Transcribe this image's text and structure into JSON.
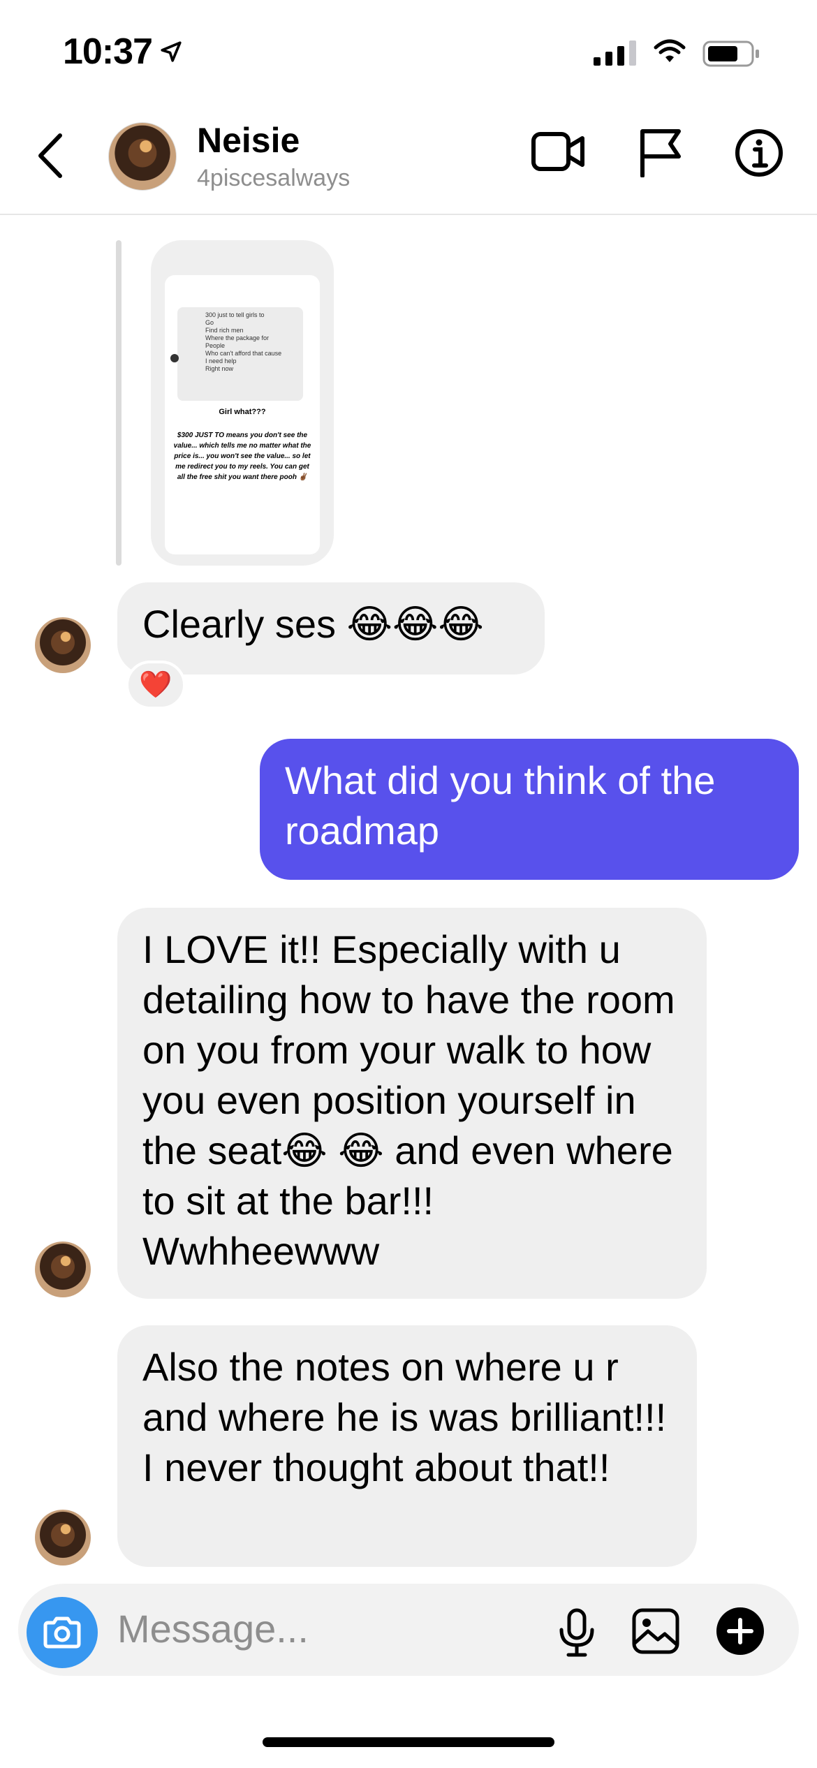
{
  "status": {
    "time": "10:37",
    "location_icon": "location-arrow-icon",
    "signal_icon": "cellular-signal-icon",
    "wifi_icon": "wifi-icon",
    "battery_icon": "battery-icon"
  },
  "header": {
    "name": "Neisie",
    "username": "4piscesalways",
    "back_icon": "chevron-left-icon",
    "actions": [
      "video-call-icon",
      "flag-icon",
      "info-icon"
    ]
  },
  "shared_story": {
    "quote": "300 just to tell girls to\nGo\nFind rich men\nWhere the package for\nPeople\nWho can't afford that cause\nI need help\nRight now",
    "title": "Girl what???",
    "body": "$300 JUST TO means you don't see the value... which tells me no matter what the price is... you won't see the value... so let me redirect you to my reels. You can get all the free shit you want there pooh ✌🏾"
  },
  "messages": [
    {
      "from": "them",
      "text": "Clearly ses 😂😂😂",
      "reaction": "❤️"
    },
    {
      "from": "me",
      "text": "What did you think of the roadmap"
    },
    {
      "from": "them",
      "text": "I LOVE it!! Especially with u detailing how to have the room on you from your walk to how you even position yourself in the seat😂 😂 and even where to sit at the bar!!!  Wwhheewww"
    },
    {
      "from": "them",
      "text": "Also the notes on where u r and where he is was brilliant!!! I never thought about that!!"
    }
  ],
  "composer": {
    "placeholder": "Message...",
    "icons": [
      "camera-icon",
      "microphone-icon",
      "image-icon",
      "plus-icon"
    ]
  },
  "colors": {
    "outgoing_bubble": "#5851ec",
    "incoming_bubble": "#efefef",
    "camera_button": "#3797f0"
  }
}
